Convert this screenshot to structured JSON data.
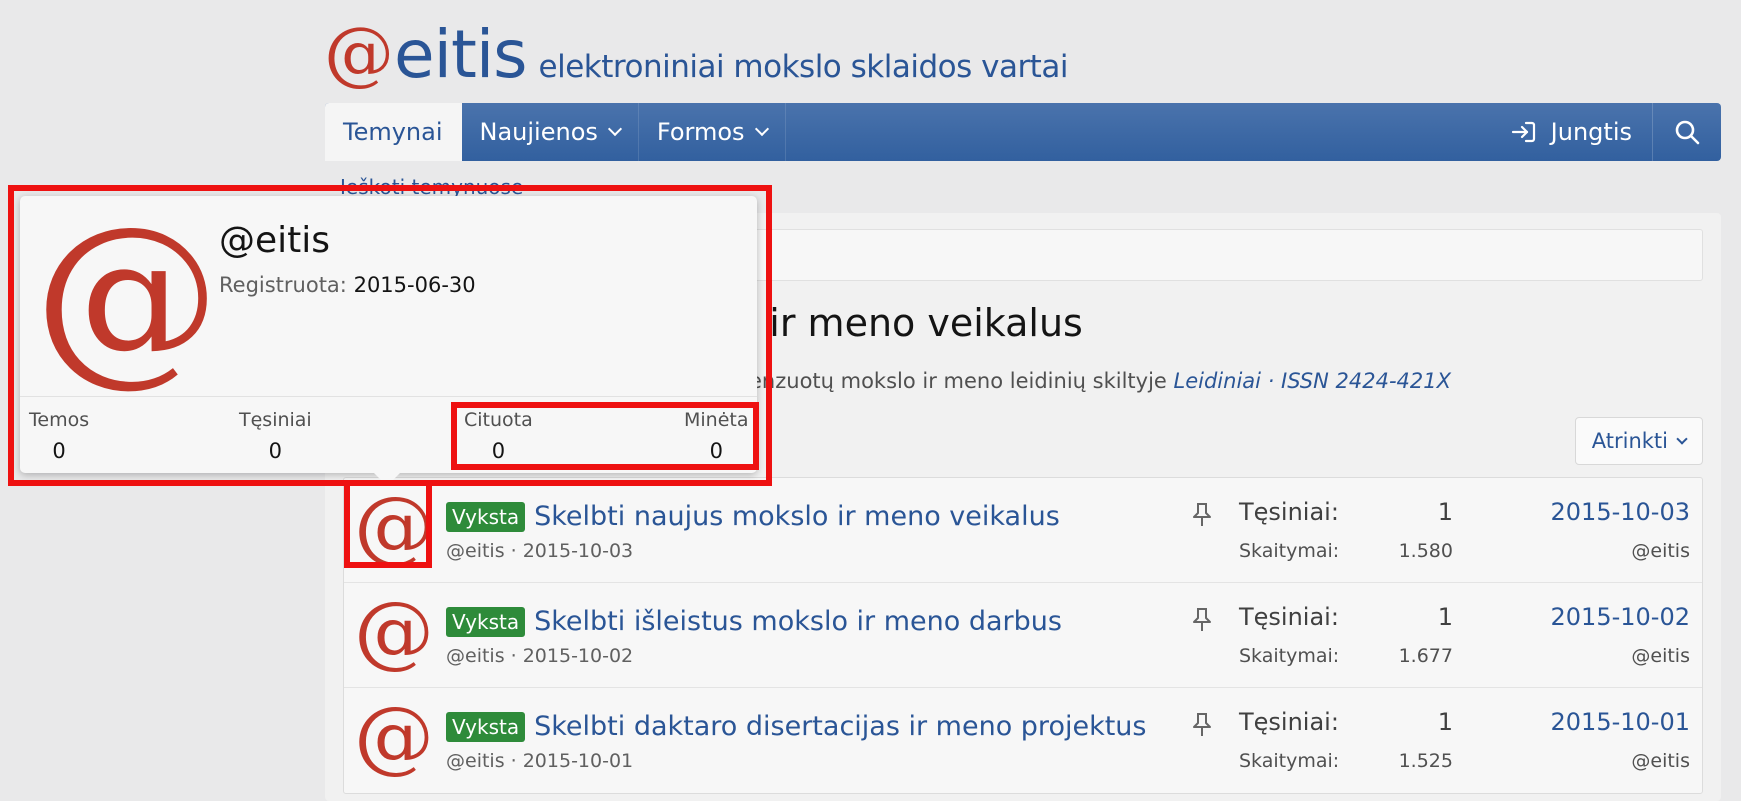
{
  "brand": {
    "logo_at": "@",
    "logo_name": "eitis",
    "tagline": "elektroniniai mokslo sklaidos vartai"
  },
  "nav": {
    "tabs": [
      {
        "label": "Temynai"
      },
      {
        "label": "Naujienos"
      },
      {
        "label": "Formos"
      }
    ],
    "login_label": "Jungtis"
  },
  "subnav": {
    "search_link": "Ieškoti temynuose"
  },
  "page": {
    "title": "Skelbti naujus mokslo ir meno veikalus",
    "description_prefix": "Temos, skirtos elektroninei sklaidai recenzuotų mokslo ir meno leidinių skiltyje",
    "description_link": "Leidiniai · ISSN 2424-421X",
    "filter_label": "Atrinkti"
  },
  "threads": [
    {
      "avatar": "@",
      "badge": "Vyksta",
      "title": "Skelbti naujus mokslo ir meno veikalus",
      "meta": "@eitis · 2015-10-03",
      "replies_label": "Tęsiniai:",
      "replies": "1",
      "views_label": "Skaitymai:",
      "views": "1.580",
      "last_date": "2015-10-03",
      "last_user": "@eitis"
    },
    {
      "avatar": "@",
      "badge": "Vyksta",
      "title": "Skelbti išleistus mokslo ir meno darbus",
      "meta": "@eitis · 2015-10-02",
      "replies_label": "Tęsiniai:",
      "replies": "1",
      "views_label": "Skaitymai:",
      "views": "1.677",
      "last_date": "2015-10-02",
      "last_user": "@eitis"
    },
    {
      "avatar": "@",
      "badge": "Vyksta",
      "title": "Skelbti daktaro disertacijas ir meno projektus",
      "meta": "@eitis · 2015-10-01",
      "replies_label": "Tęsiniai:",
      "replies": "1",
      "views_label": "Skaitymai:",
      "views": "1.525",
      "last_date": "2015-10-01",
      "last_user": "@eitis"
    }
  ],
  "popup": {
    "avatar": "@",
    "name": "@eitis",
    "registered_label": "Registruota:",
    "registered_value": "2015-06-30",
    "stats": [
      {
        "label": "Temos",
        "value": "0"
      },
      {
        "label": "Tęsiniai",
        "value": "0"
      },
      {
        "label": "Cituota",
        "value": "0"
      },
      {
        "label": "Minėta",
        "value": "0"
      }
    ]
  },
  "colors": {
    "brand_red": "#c0392b",
    "brand_blue": "#2a5596",
    "badge_green": "#2e8b3a",
    "highlight_red": "#ee1111"
  }
}
